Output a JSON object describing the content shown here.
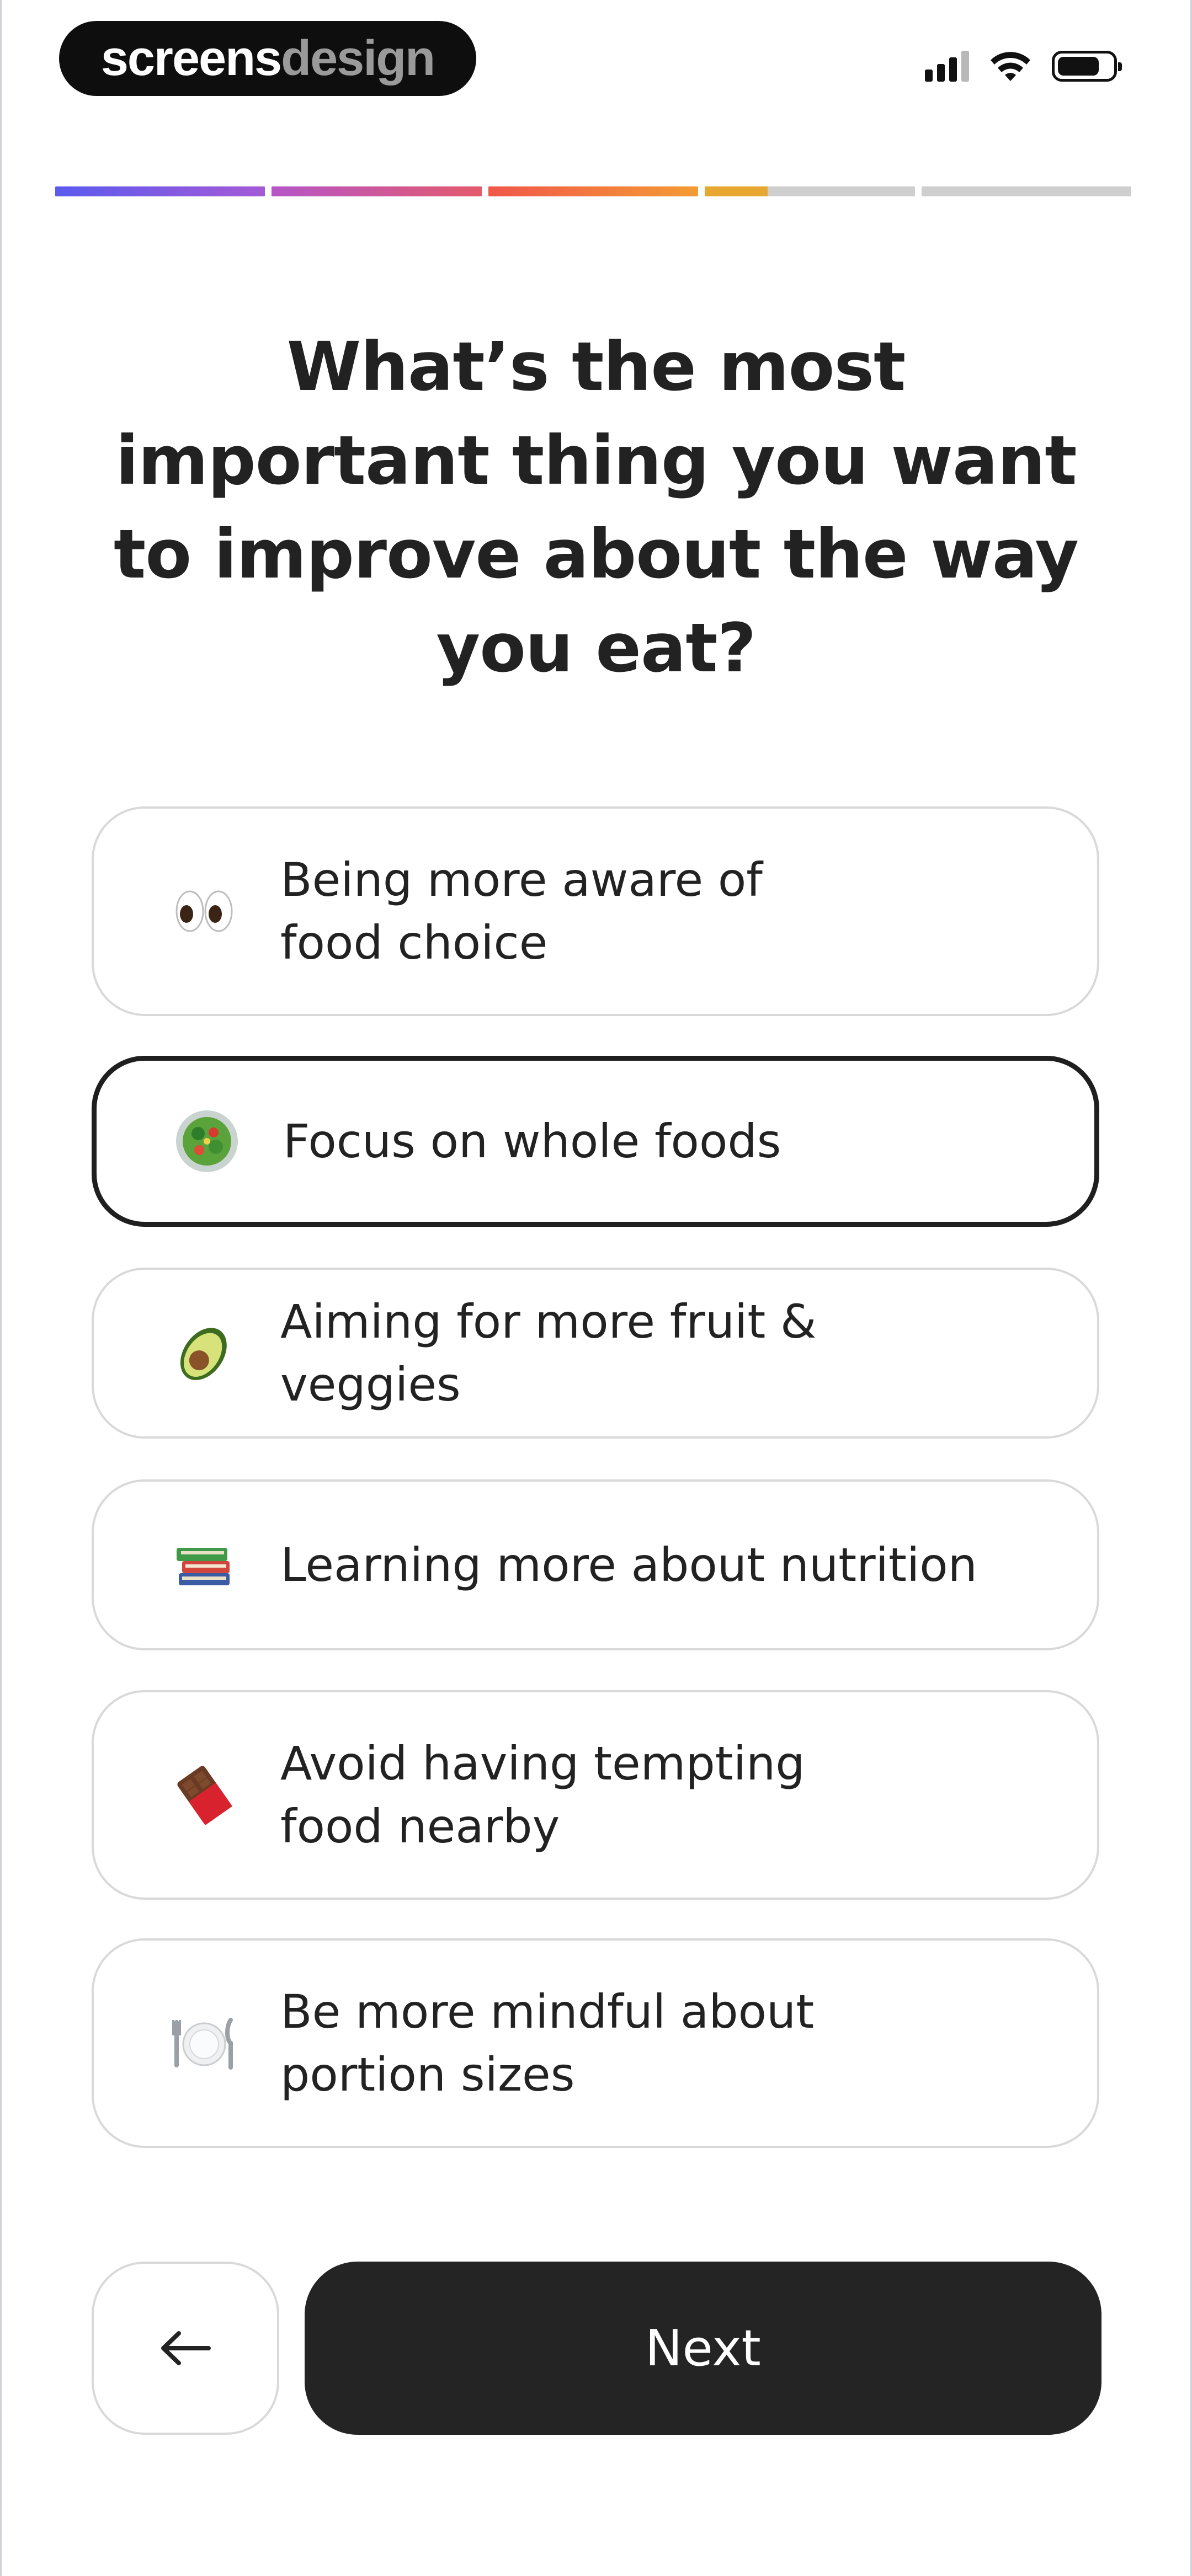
{
  "status_bar": {
    "brand_primary": "screens",
    "brand_secondary": "design",
    "battery_level": 0.8,
    "signal_bars": 4,
    "signal_active": 3
  },
  "progress": {
    "segments": [
      {
        "fill": 1.0,
        "color": "linear-gradient(90deg,#5b5bef,#a45ad6)"
      },
      {
        "fill": 1.0,
        "color": "linear-gradient(90deg,#b656c9,#e35a6d)"
      },
      {
        "fill": 1.0,
        "color": "linear-gradient(90deg,#f0574a,#f49b34)"
      },
      {
        "fill": 0.3,
        "color": "#e8a730"
      },
      {
        "fill": 0.0,
        "color": "#cfcfcf"
      }
    ],
    "track_color": "#cfcfcf"
  },
  "question": {
    "title": "What’s the most important thing you want to improve about the way you eat?"
  },
  "options": [
    {
      "icon": "eyes-icon",
      "label_line1": "Being more aware of",
      "label_line2": "food choice",
      "selected": false
    },
    {
      "icon": "salad-icon",
      "label_line1": "Focus on whole foods",
      "label_line2": "",
      "selected": true
    },
    {
      "icon": "avocado-icon",
      "label_line1": "Aiming for more fruit & veggies",
      "label_line2": "",
      "selected": false
    },
    {
      "icon": "books-icon",
      "label_line1": "Learning more about nutrition",
      "label_line2": "",
      "selected": false
    },
    {
      "icon": "chocolate-icon",
      "label_line1": "Avoid having tempting",
      "label_line2": "food nearby",
      "selected": false
    },
    {
      "icon": "plate-cutlery-icon",
      "label_line1": "Be more mindful about",
      "label_line2": "portion sizes",
      "selected": false
    }
  ],
  "footer": {
    "back_icon": "arrow-left-icon",
    "next_label": "Next"
  },
  "colors": {
    "primary": "#242424",
    "border": "#d9d9d9",
    "text": "#222222"
  }
}
